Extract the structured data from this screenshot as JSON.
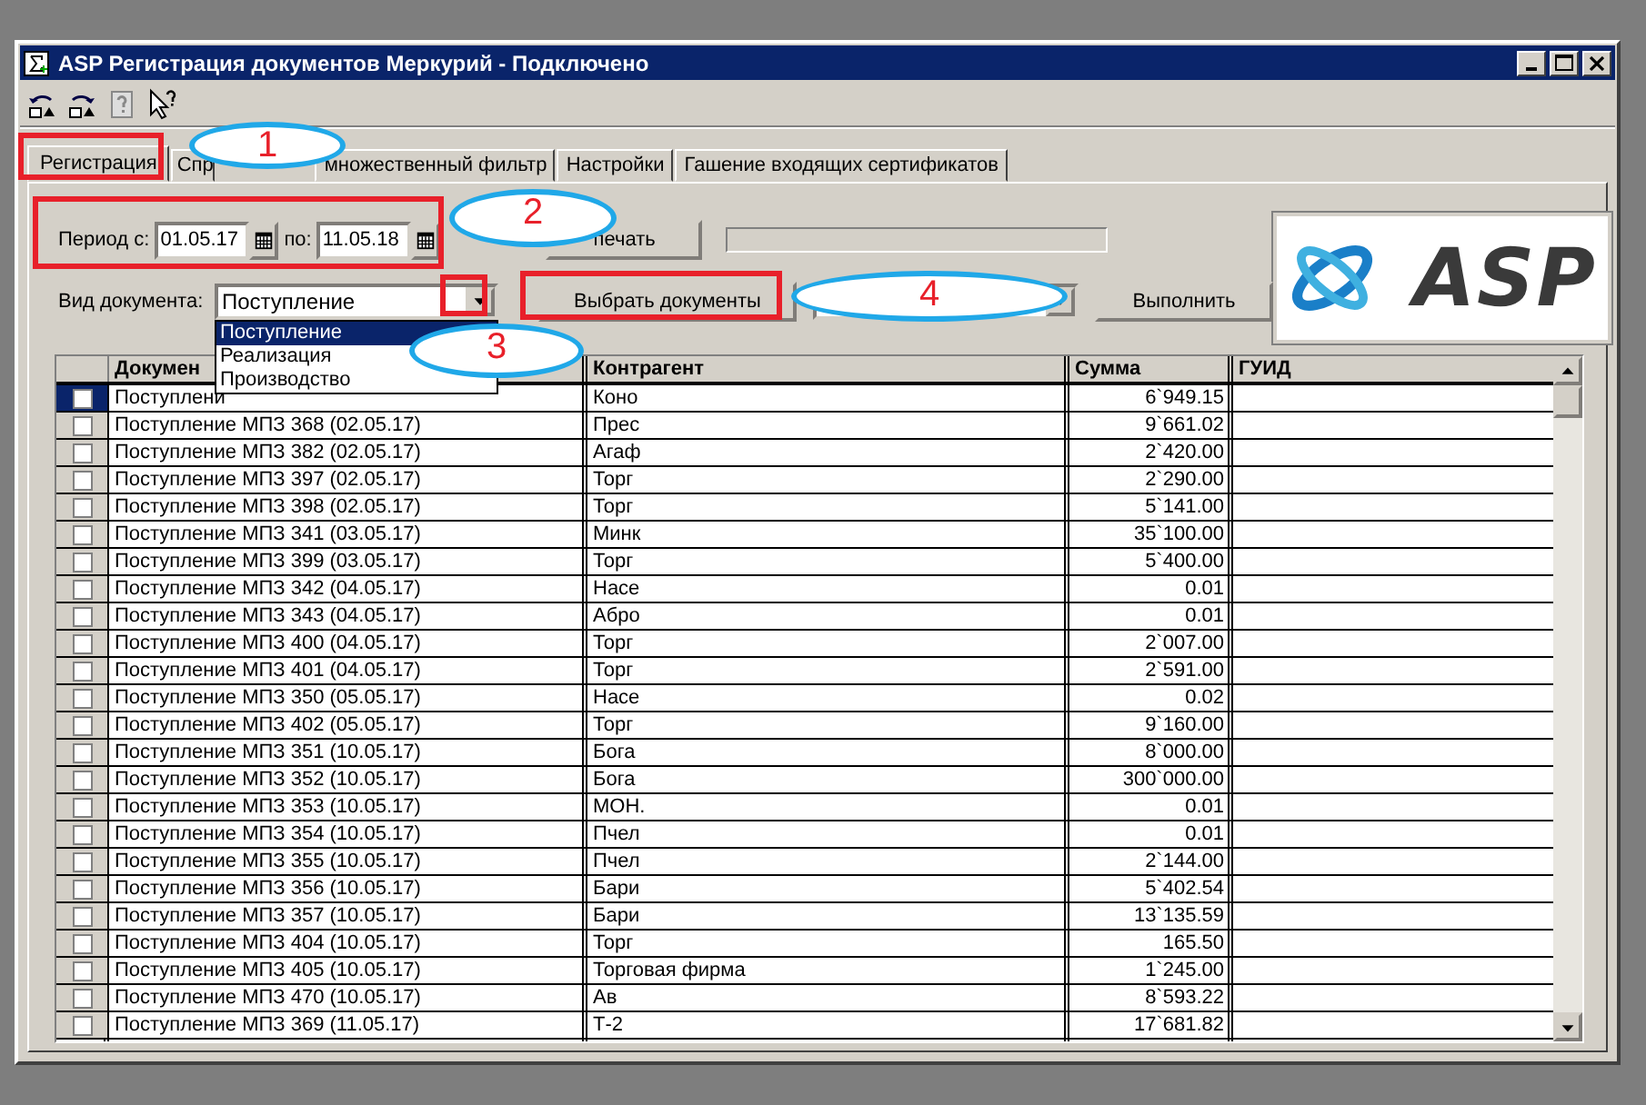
{
  "window": {
    "title": "ASP Регистрация документов Меркурий - Подключено"
  },
  "tabs": [
    {
      "label": "Регистрация",
      "selected": true
    },
    {
      "label": "Спр",
      "selected": false
    },
    {
      "label": "множественный фильтр",
      "selected": false
    },
    {
      "label": "Настройки",
      "selected": false
    },
    {
      "label": "Гашение входящих сертификатов",
      "selected": false
    }
  ],
  "period": {
    "label_from": "Период с:",
    "from": "01.05.17",
    "label_to": "по:",
    "to": "11.05.18"
  },
  "print_button": "печать",
  "progress": {
    "level": 0
  },
  "doc_type": {
    "label": "Вид документа:",
    "value": "Поступление",
    "expanded": true,
    "options": [
      {
        "label": "Поступление",
        "selected": true
      },
      {
        "label": "Реализация",
        "selected": false
      },
      {
        "label": "Производство",
        "selected": false
      }
    ]
  },
  "select_button": "Выбрать документы",
  "run_button": "Выполнить",
  "logo": {
    "text": "ASP"
  },
  "table": {
    "columns": [
      "Докумен",
      "Контрагент",
      "Сумма",
      "ГУИД"
    ],
    "rows": [
      {
        "checked": false,
        "selected": true,
        "document": "Поступлени",
        "counterparty": "Коно",
        "sum": "6`949.15"
      },
      {
        "checked": false,
        "selected": false,
        "document": "Поступление МПЗ 368 (02.05.17)",
        "counterparty": "Прес",
        "sum": "9`661.02"
      },
      {
        "checked": false,
        "selected": false,
        "document": "Поступление МПЗ 382 (02.05.17)",
        "counterparty": "Агаф",
        "sum": "2`420.00"
      },
      {
        "checked": false,
        "selected": false,
        "document": "Поступление МПЗ 397 (02.05.17)",
        "counterparty": "Торг",
        "sum": "2`290.00"
      },
      {
        "checked": false,
        "selected": false,
        "document": "Поступление МПЗ 398 (02.05.17)",
        "counterparty": "Торг",
        "sum": "5`141.00"
      },
      {
        "checked": false,
        "selected": false,
        "document": "Поступление МПЗ 341 (03.05.17)",
        "counterparty": "Минк",
        "sum": "35`100.00"
      },
      {
        "checked": false,
        "selected": false,
        "document": "Поступление МПЗ 399 (03.05.17)",
        "counterparty": "Торг",
        "sum": "5`400.00"
      },
      {
        "checked": false,
        "selected": false,
        "document": "Поступление МПЗ 342 (04.05.17)",
        "counterparty": "Насе",
        "sum": "0.01"
      },
      {
        "checked": false,
        "selected": false,
        "document": "Поступление МПЗ 343 (04.05.17)",
        "counterparty": "Абро",
        "sum": "0.01"
      },
      {
        "checked": false,
        "selected": false,
        "document": "Поступление МПЗ 400 (04.05.17)",
        "counterparty": "Торг",
        "sum": "2`007.00"
      },
      {
        "checked": false,
        "selected": false,
        "document": "Поступление МПЗ 401 (04.05.17)",
        "counterparty": "Торг",
        "sum": "2`591.00"
      },
      {
        "checked": false,
        "selected": false,
        "document": "Поступление МПЗ 350 (05.05.17)",
        "counterparty": "Насе",
        "sum": "0.02"
      },
      {
        "checked": false,
        "selected": false,
        "document": "Поступление МПЗ 402 (05.05.17)",
        "counterparty": "Торг",
        "sum": "9`160.00"
      },
      {
        "checked": false,
        "selected": false,
        "document": "Поступление МПЗ 351 (10.05.17)",
        "counterparty": "Бога",
        "sum": "8`000.00"
      },
      {
        "checked": false,
        "selected": false,
        "document": "Поступление МПЗ 352 (10.05.17)",
        "counterparty": "Бога",
        "sum": "300`000.00"
      },
      {
        "checked": false,
        "selected": false,
        "document": "Поступление МПЗ 353 (10.05.17)",
        "counterparty": "МОН.",
        "sum": "0.01"
      },
      {
        "checked": false,
        "selected": false,
        "document": "Поступление МПЗ 354 (10.05.17)",
        "counterparty": "Пчел",
        "sum": "0.01"
      },
      {
        "checked": false,
        "selected": false,
        "document": "Поступление МПЗ 355 (10.05.17)",
        "counterparty": "Пчел",
        "sum": "2`144.00"
      },
      {
        "checked": false,
        "selected": false,
        "document": "Поступление МПЗ 356 (10.05.17)",
        "counterparty": "Бари",
        "sum": "5`402.54"
      },
      {
        "checked": false,
        "selected": false,
        "document": "Поступление МПЗ 357 (10.05.17)",
        "counterparty": "Бари",
        "sum": "13`135.59"
      },
      {
        "checked": false,
        "selected": false,
        "document": "Поступление МПЗ 404 (10.05.17)",
        "counterparty": "Торг",
        "sum": "165.50"
      },
      {
        "checked": false,
        "selected": false,
        "document": "Поступление МПЗ 405 (10.05.17)",
        "counterparty": "Торговая фирма",
        "sum": "1`245.00"
      },
      {
        "checked": false,
        "selected": false,
        "document": "Поступление МПЗ 470 (10.05.17)",
        "counterparty": "Ав",
        "sum": "8`593.22"
      },
      {
        "checked": false,
        "selected": false,
        "document": "Поступление МПЗ 369 (11.05.17)",
        "counterparty": "Т-2",
        "sum": "17`681.82"
      }
    ]
  },
  "annotations": [
    {
      "kind": "box"
    },
    {
      "kind": "ellipse",
      "label": "1"
    },
    {
      "kind": "box"
    },
    {
      "kind": "ellipse",
      "label": "2"
    },
    {
      "kind": "box"
    },
    {
      "kind": "ellipse",
      "label": "3"
    },
    {
      "kind": "box"
    },
    {
      "kind": "ellipse",
      "label": "4"
    }
  ]
}
